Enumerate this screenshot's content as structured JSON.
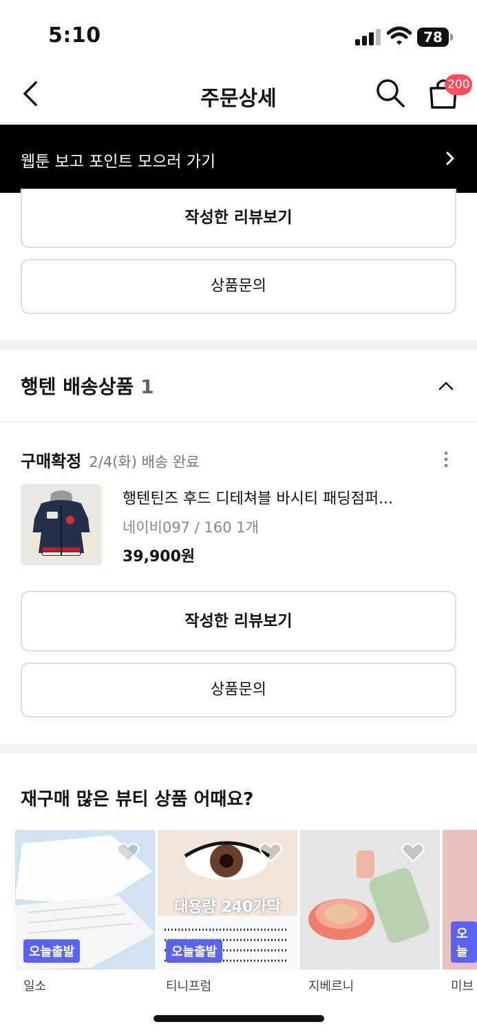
{
  "status_bar": {
    "time": "5:10",
    "battery": "78"
  },
  "header": {
    "title": "주문상세",
    "cart_count": "200"
  },
  "banner": {
    "text": "웹툰 보고 포인트 모으러 가기"
  },
  "top_buttons": {
    "review": "작성한 리뷰보기",
    "inquiry": "상품문의"
  },
  "section": {
    "title": "행텐 배송상품",
    "count": "1"
  },
  "order": {
    "status": "구매확정",
    "delivery": "2/4(화) 배송 완료",
    "product_name": "행텐틴즈 후드 디테쳐블 바시티 패딩점퍼...",
    "option": "네이비097 / 160 1개",
    "price": "39,900원",
    "review_button": "작성한 리뷰보기",
    "inquiry_button": "상품문의"
  },
  "recommend": {
    "title": "재구매 많은 뷰티 상품 어때요?",
    "items": [
      {
        "brand": "일소",
        "badge": "오늘출발",
        "overlay": ""
      },
      {
        "brand": "티니프럼",
        "badge": "오늘출발",
        "overlay": "대용량 240가닥"
      },
      {
        "brand": "지베르니",
        "badge": "",
        "overlay": ""
      },
      {
        "brand": "미브",
        "badge": "오늘",
        "overlay": ""
      }
    ]
  },
  "colors": {
    "accent_badge": "#5b63f5",
    "cart_badge": "#ff4d5e"
  }
}
